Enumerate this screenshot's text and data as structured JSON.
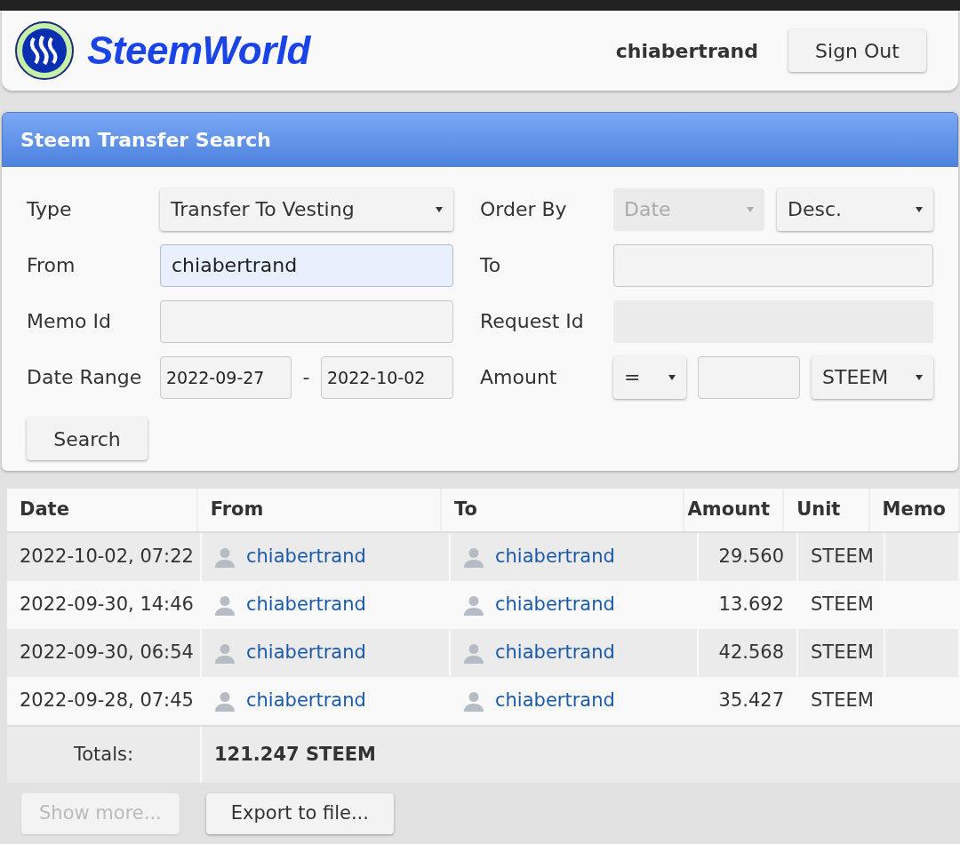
{
  "header": {
    "logo_text": "SteemWorld",
    "username": "chiabertrand",
    "sign_out": "Sign Out"
  },
  "panel": {
    "title": "Steem Transfer Search",
    "rows": [
      {
        "left": {
          "label": "Type",
          "controls": [
            {
              "kind": "select",
              "value": "Transfer To Vesting",
              "disabled": false
            }
          ]
        },
        "right": {
          "label": "Order By",
          "controls": [
            {
              "kind": "select",
              "value": "Date",
              "disabled": true
            },
            {
              "kind": "select",
              "value": "Desc.",
              "disabled": false
            }
          ]
        }
      },
      {
        "left": {
          "label": "From",
          "controls": [
            {
              "kind": "input",
              "value": "chiabertrand",
              "disabled": false,
              "highlighted": true
            }
          ]
        },
        "right": {
          "label": "To",
          "controls": [
            {
              "kind": "input",
              "disabled": false,
              "highlighted": false
            }
          ]
        }
      },
      {
        "left": {
          "label": "Memo Id",
          "controls": [
            {
              "kind": "input",
              "disabled": false,
              "highlighted": false
            }
          ]
        },
        "right": {
          "label": "Request Id",
          "controls": [
            {
              "kind": "input",
              "disabled": true,
              "highlighted": false
            }
          ]
        }
      },
      {
        "left": {
          "label": "Date Range",
          "controls": [
            {
              "kind": "input",
              "value": "2022-09-27",
              "disabled": false,
              "highlighted": false
            },
            {
              "kind": "separator",
              "value": "-"
            },
            {
              "kind": "input",
              "value": "2022-10-02",
              "disabled": false,
              "highlighted": false
            }
          ]
        },
        "right": {
          "label": "Amount",
          "controls": [
            {
              "kind": "select",
              "value": "=",
              "disabled": false
            },
            {
              "kind": "input",
              "disabled": false,
              "highlighted": false
            },
            {
              "kind": "select",
              "value": "STEEM",
              "disabled": false
            }
          ]
        }
      }
    ],
    "search_button": "Search"
  },
  "table": {
    "columns": [
      "Date",
      "From",
      "To",
      "Amount",
      "Unit",
      "Memo"
    ],
    "rows": [
      {
        "date": "2022-10-02, 07:22",
        "from": "chiabertrand",
        "to": "chiabertrand",
        "amount": "29.560",
        "unit": "STEEM"
      },
      {
        "date": "2022-09-30, 14:46",
        "from": "chiabertrand",
        "to": "chiabertrand",
        "amount": "13.692",
        "unit": "STEEM"
      },
      {
        "date": "2022-09-30, 06:54",
        "from": "chiabertrand",
        "to": "chiabertrand",
        "amount": "42.568",
        "unit": "STEEM"
      },
      {
        "date": "2022-09-28, 07:45",
        "from": "chiabertrand",
        "to": "chiabertrand",
        "amount": "35.427",
        "unit": "STEEM"
      }
    ],
    "totals_label": "Totals:",
    "totals_value": "121.247 STEEM"
  },
  "buttons": [
    {
      "label": "Show more...",
      "disabled": true
    },
    {
      "label": "Export to file...",
      "disabled": false
    }
  ]
}
